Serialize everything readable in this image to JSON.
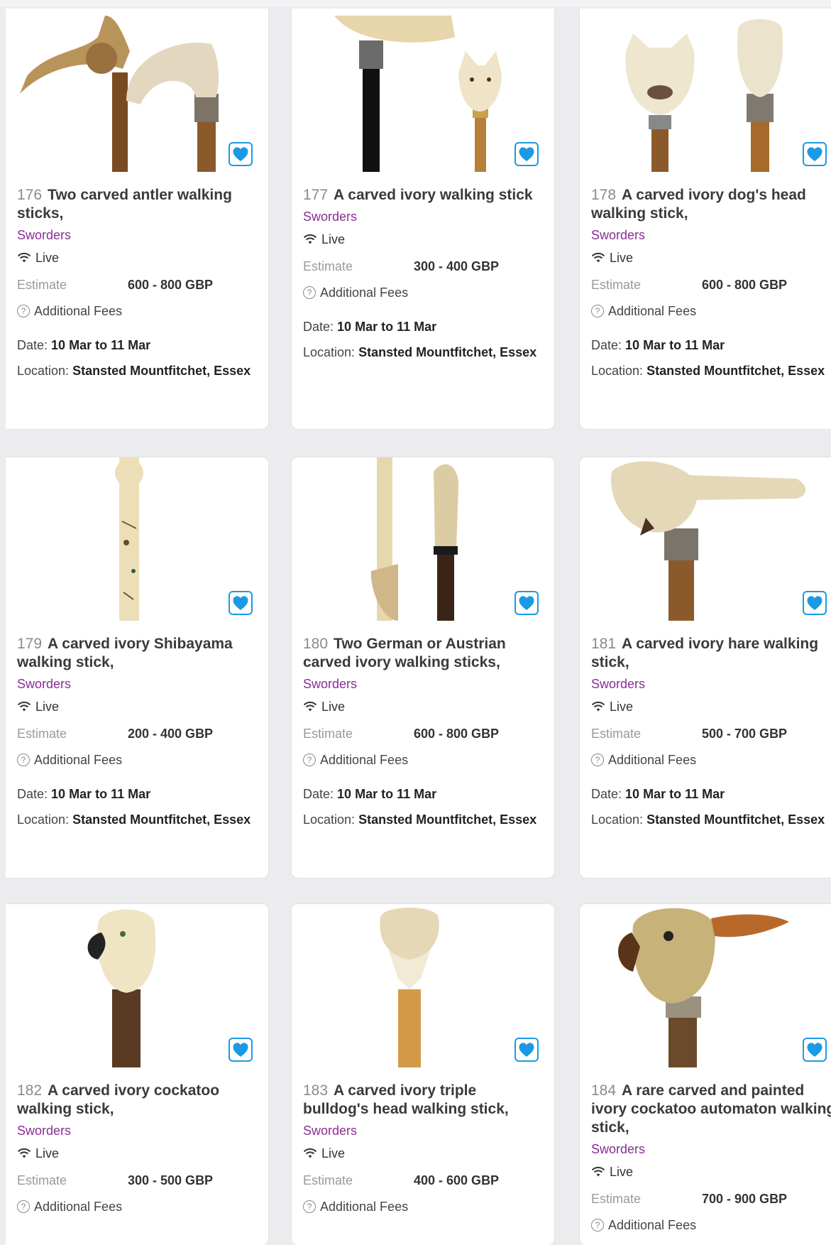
{
  "labels": {
    "estimate": "Estimate",
    "additional_fees": "Additional Fees",
    "date_prefix": "Date:",
    "location_prefix": "Location:"
  },
  "colors": {
    "auction_house": "#8a2d95",
    "favorite_accent": "#1b9ae4"
  },
  "lots": [
    {
      "number": "176",
      "title": "Two carved antler walking sticks,",
      "house": "Sworders",
      "status": "Live",
      "estimate": "600 - 800 GBP",
      "date": "10 Mar to 11 Mar",
      "location": "Stansted Mountfitchet, Essex"
    },
    {
      "number": "177",
      "title": "A carved ivory walking stick",
      "house": "Sworders",
      "status": "Live",
      "estimate": "300 - 400 GBP",
      "date": "10 Mar to 11 Mar",
      "location": "Stansted Mountfitchet, Essex"
    },
    {
      "number": "178",
      "title": "A carved ivory dog's head walking stick,",
      "house": "Sworders",
      "status": "Live",
      "estimate": "600 - 800 GBP",
      "date": "10 Mar to 11 Mar",
      "location": "Stansted Mountfitchet, Essex"
    },
    {
      "number": "179",
      "title": "A carved ivory Shibayama walking stick,",
      "house": "Sworders",
      "status": "Live",
      "estimate": "200 - 400 GBP",
      "date": "10 Mar to 11 Mar",
      "location": "Stansted Mountfitchet, Essex"
    },
    {
      "number": "180",
      "title": "Two German or Austrian carved ivory walking sticks,",
      "house": "Sworders",
      "status": "Live",
      "estimate": "600 - 800 GBP",
      "date": "10 Mar to 11 Mar",
      "location": "Stansted Mountfitchet, Essex"
    },
    {
      "number": "181",
      "title": "A carved ivory hare walking stick,",
      "house": "Sworders",
      "status": "Live",
      "estimate": "500 - 700 GBP",
      "date": "10 Mar to 11 Mar",
      "location": "Stansted Mountfitchet, Essex"
    },
    {
      "number": "182",
      "title": "A carved ivory cockatoo walking stick,",
      "house": "Sworders",
      "status": "Live",
      "estimate": "300 - 500 GBP"
    },
    {
      "number": "183",
      "title": "A carved ivory triple bulldog's head walking stick,",
      "house": "Sworders",
      "status": "Live",
      "estimate": "400 - 600 GBP"
    },
    {
      "number": "184",
      "title": "A rare carved and painted ivory cockatoo automaton walking stick,",
      "house": "Sworders",
      "status": "Live",
      "estimate": "700 - 900 GBP"
    }
  ]
}
